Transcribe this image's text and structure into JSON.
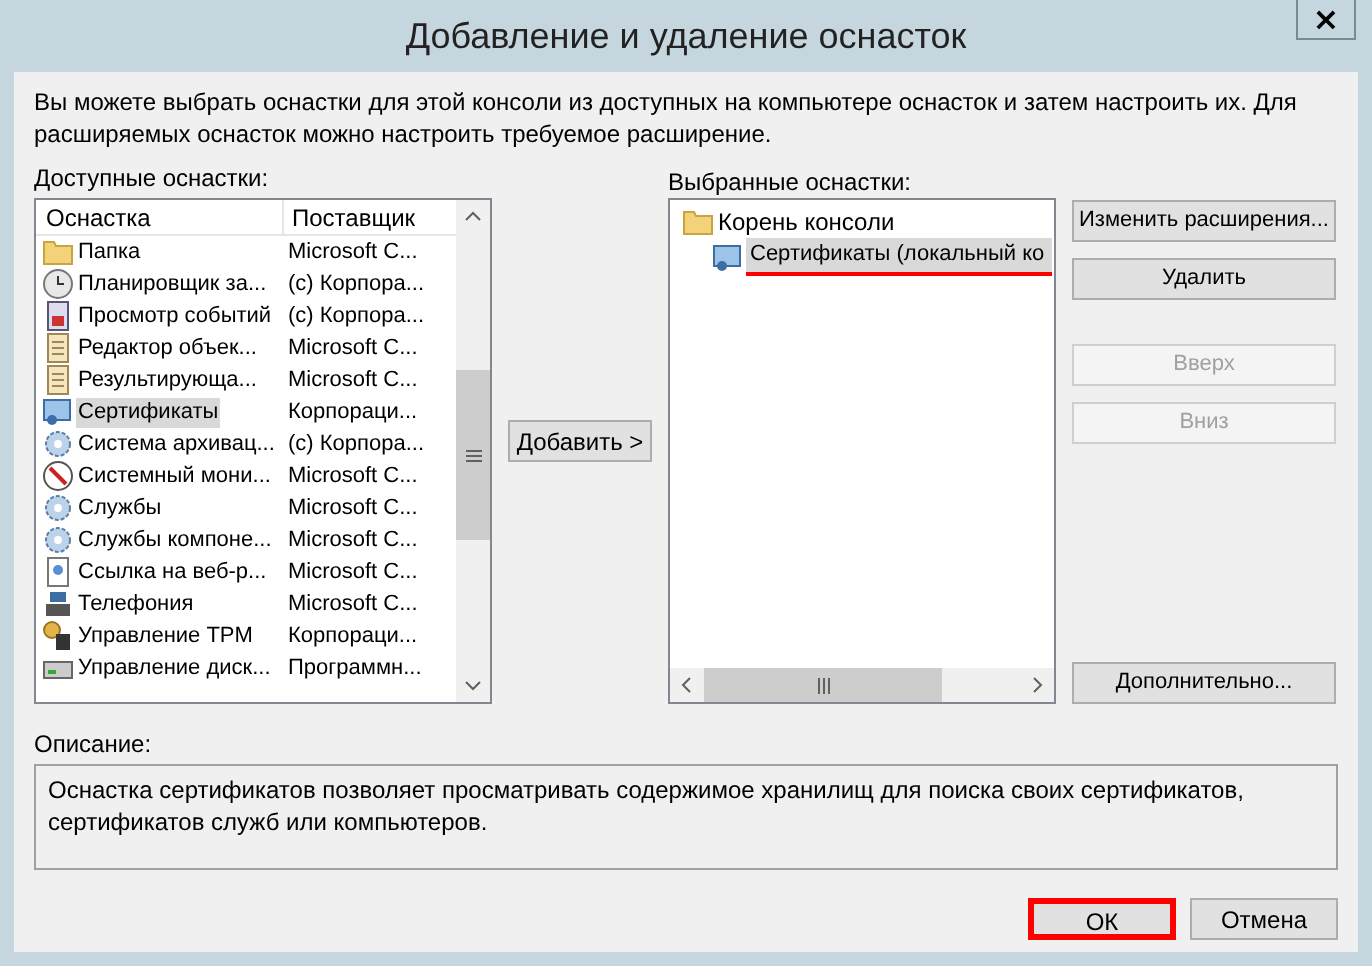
{
  "window": {
    "title": "Добавление и удаление оснасток",
    "close": "×"
  },
  "intro": "Вы можете выбрать оснастки для этой консоли из доступных на компьютере оснасток и затем настроить их. Для расширяемых оснасток можно настроить требуемое расширение.",
  "available": {
    "label": "Доступные оснастки:",
    "columns": [
      "Оснастка",
      "Поставщик"
    ],
    "rows": [
      {
        "name": "Папка",
        "vendor": "Microsoft C...",
        "selected": false
      },
      {
        "name": "Планировщик за...",
        "vendor": "(c) Корпора...",
        "selected": false
      },
      {
        "name": "Просмотр событий",
        "vendor": "(c) Корпора...",
        "selected": false
      },
      {
        "name": "Редактор объек...",
        "vendor": "Microsoft C...",
        "selected": false
      },
      {
        "name": "Результирующа...",
        "vendor": "Microsoft C...",
        "selected": false
      },
      {
        "name": "Сертификаты",
        "vendor": "Корпораци...",
        "selected": true
      },
      {
        "name": "Система архивац...",
        "vendor": "(c) Корпора...",
        "selected": false
      },
      {
        "name": "Системный мони...",
        "vendor": "Microsoft C...",
        "selected": false
      },
      {
        "name": "Службы",
        "vendor": "Microsoft C...",
        "selected": false
      },
      {
        "name": "Службы компоне...",
        "vendor": "Microsoft C...",
        "selected": false
      },
      {
        "name": "Ссылка на веб-р...",
        "vendor": "Microsoft C...",
        "selected": false
      },
      {
        "name": "Телефония",
        "vendor": "Microsoft C...",
        "selected": false
      },
      {
        "name": "Управление TPM",
        "vendor": "Корпораци...",
        "selected": false
      },
      {
        "name": "Управление диск...",
        "vendor": "Программн...",
        "selected": false
      }
    ]
  },
  "add_button": "Добавить >",
  "selected_snapins": {
    "label": "Выбранные оснастки:",
    "tree": [
      {
        "name": "Корень консоли",
        "selected": false,
        "highlighted": false,
        "children": [
          {
            "name": "Сертификаты (локальный ко",
            "selected": true,
            "highlighted": true
          }
        ]
      }
    ]
  },
  "side_buttons": [
    {
      "label": "Изменить расширения...",
      "disabled": false
    },
    {
      "label": "Удалить",
      "disabled": false
    },
    {
      "label": "Вверх",
      "disabled": true
    },
    {
      "label": "Вниз",
      "disabled": true
    },
    {
      "label": "Дополнительно...",
      "disabled": false
    }
  ],
  "description": {
    "label": "Описание:",
    "text": "Оснастка сертификатов позволяет просматривать содержимое хранилищ для поиска своих сертификатов, сертификатов служб или компьютеров."
  },
  "footer_buttons": [
    {
      "label": "ОК",
      "highlighted": true
    },
    {
      "label": "Отмена",
      "highlighted": false
    }
  ]
}
